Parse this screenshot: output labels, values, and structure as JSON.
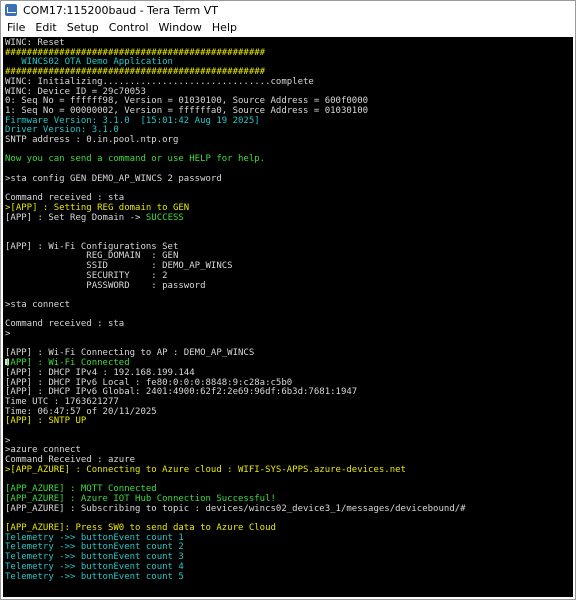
{
  "window": {
    "title": "COM17:115200baud - Tera Term VT",
    "menu": [
      "File",
      "Edit",
      "Setup",
      "Control",
      "Window",
      "Help"
    ]
  },
  "colors": {
    "default": "#d8d8d8",
    "green": "#3ddc3d",
    "cyan": "#20c8c8",
    "yellow": "#e8e800",
    "blue": "#3a78ff",
    "background": "#000000"
  },
  "terminal": {
    "lines": [
      {
        "segments": [
          {
            "text": "WINC: Reset",
            "color": "default"
          }
        ]
      },
      {
        "segments": [
          {
            "text": "################################################",
            "color": "yellow"
          }
        ]
      },
      {
        "segments": [
          {
            "text": "   WINCS02 OTA Demo Application",
            "color": "cyan"
          }
        ]
      },
      {
        "segments": [
          {
            "text": "################################################",
            "color": "yellow"
          }
        ]
      },
      {
        "segments": [
          {
            "text": "WINC: Initializing...............................complete",
            "color": "default"
          }
        ]
      },
      {
        "segments": [
          {
            "text": "WINC: Device ID = 29c70053",
            "color": "default"
          }
        ]
      },
      {
        "segments": [
          {
            "text": "0: Seq No = ffffff98, Version = 01030100, Source Address = 600f0000",
            "color": "default"
          }
        ]
      },
      {
        "segments": [
          {
            "text": "1: Seq No = 00000002, Version = ffffffa0, Source Address = 01030100",
            "color": "default"
          }
        ]
      },
      {
        "segments": [
          {
            "text": "Firmware Version: 3.1.0  [15:01:42 Aug 19 2025]",
            "color": "cyan"
          }
        ]
      },
      {
        "segments": [
          {
            "text": "Driver Version: 3.1.0",
            "color": "cyan"
          }
        ]
      },
      {
        "segments": [
          {
            "text": "SNTP address : 0.in.pool.ntp.org",
            "color": "default"
          }
        ]
      },
      {
        "segments": [
          {
            "text": "",
            "color": "default"
          }
        ]
      },
      {
        "segments": [
          {
            "text": "Now you can send a command or use HELP for help.",
            "color": "green"
          }
        ]
      },
      {
        "segments": [
          {
            "text": "",
            "color": "default"
          }
        ]
      },
      {
        "segments": [
          {
            "text": ">sta config GEN DEMO_AP_WINCS 2 password",
            "color": "default"
          }
        ]
      },
      {
        "segments": [
          {
            "text": "",
            "color": "default"
          }
        ]
      },
      {
        "segments": [
          {
            "text": "Command received : sta",
            "color": "default"
          }
        ]
      },
      {
        "segments": [
          {
            "text": ">[APP] : Setting REG domain to GEN",
            "color": "yellow"
          }
        ]
      },
      {
        "segments": [
          {
            "text": "[APP] : Set Reg Domain -> ",
            "color": "default"
          },
          {
            "text": "SUCCESS",
            "color": "green"
          }
        ]
      },
      {
        "segments": [
          {
            "text": "",
            "color": "default"
          }
        ]
      },
      {
        "segments": [
          {
            "text": "",
            "color": "default"
          }
        ]
      },
      {
        "segments": [
          {
            "text": "[APP] : Wi-Fi Configurations Set",
            "color": "default"
          }
        ]
      },
      {
        "segments": [
          {
            "text": "               REG_DOMAIN  : GEN",
            "color": "default"
          }
        ]
      },
      {
        "segments": [
          {
            "text": "               SSID        : DEMO_AP_WINCS",
            "color": "default"
          }
        ]
      },
      {
        "segments": [
          {
            "text": "               SECURITY    : 2",
            "color": "default"
          }
        ]
      },
      {
        "segments": [
          {
            "text": "               PASSWORD    : password",
            "color": "default"
          }
        ]
      },
      {
        "segments": [
          {
            "text": "",
            "color": "default"
          }
        ]
      },
      {
        "segments": [
          {
            "text": ">sta connect",
            "color": "default"
          }
        ]
      },
      {
        "segments": [
          {
            "text": "",
            "color": "default"
          }
        ]
      },
      {
        "segments": [
          {
            "text": "Command received : sta",
            "color": "default"
          }
        ]
      },
      {
        "segments": [
          {
            "text": ">",
            "color": "default"
          }
        ]
      },
      {
        "segments": [
          {
            "text": "",
            "color": "default"
          }
        ]
      },
      {
        "segments": [
          {
            "text": "[APP] : Wi-Fi Connecting to AP : DEMO_AP_WINCS",
            "color": "default"
          }
        ]
      },
      {
        "segments": [
          {
            "text": "[APP] : Wi-Fi Connected",
            "color": "green"
          }
        ]
      },
      {
        "segments": [
          {
            "text": "[APP] : DHCP IPv4 : 192.168.199.144",
            "color": "default"
          }
        ]
      },
      {
        "segments": [
          {
            "text": "[APP] : DHCP IPv6 Local : fe80:0:0:0:8848:9:c28a:c5b0",
            "color": "default"
          }
        ]
      },
      {
        "segments": [
          {
            "text": "[APP] : DHCP IPv6 Global: 2401:4900:62f2:2e69:96df:6b3d:7681:1947",
            "color": "default"
          }
        ]
      },
      {
        "segments": [
          {
            "text": "Time UTC : 1763621277",
            "color": "default"
          }
        ]
      },
      {
        "segments": [
          {
            "text": "Time: 06:47:57 of 20/11/2025",
            "color": "default"
          }
        ]
      },
      {
        "segments": [
          {
            "text": "[APP] : SNTP UP",
            "color": "yellow"
          }
        ]
      },
      {
        "segments": [
          {
            "text": "",
            "color": "default"
          }
        ]
      },
      {
        "segments": [
          {
            "text": ">",
            "color": "default"
          }
        ]
      },
      {
        "segments": [
          {
            "text": ">azure connect",
            "color": "default"
          }
        ]
      },
      {
        "segments": [
          {
            "text": "Command Received : azure",
            "color": "default"
          }
        ]
      },
      {
        "segments": [
          {
            "text": ">[APP_AZURE] : Connecting to Azure cloud : WIFI-SYS-APPS.azure-devices.net",
            "color": "yellow"
          }
        ]
      },
      {
        "segments": [
          {
            "text": "",
            "color": "default"
          }
        ]
      },
      {
        "segments": [
          {
            "text": "[APP_AZURE] : MQTT Connected",
            "color": "green"
          }
        ]
      },
      {
        "segments": [
          {
            "text": "[APP_AZURE] : Azure IOT Hub Connection Successful!",
            "color": "green"
          }
        ]
      },
      {
        "segments": [
          {
            "text": "[APP_AZURE] : Subscribing to topic : devices/wincs02_device3_1/messages/devicebound/#",
            "color": "default"
          }
        ]
      },
      {
        "segments": [
          {
            "text": "",
            "color": "default"
          }
        ]
      },
      {
        "segments": [
          {
            "text": "[APP_AZURE]: Press SW0 to send data to Azure Cloud",
            "color": "yellow"
          }
        ]
      },
      {
        "segments": [
          {
            "text": "Telemetry ->> buttonEvent count 1",
            "color": "cyan"
          }
        ]
      },
      {
        "segments": [
          {
            "text": "Telemetry ->> buttonEvent count 2",
            "color": "cyan"
          }
        ]
      },
      {
        "segments": [
          {
            "text": "Telemetry ->> buttonEvent count 3",
            "color": "cyan"
          }
        ]
      },
      {
        "segments": [
          {
            "text": "Telemetry ->> buttonEvent count 4",
            "color": "cyan"
          }
        ]
      },
      {
        "segments": [
          {
            "text": "Telemetry ->> buttonEvent count 5",
            "color": "cyan"
          }
        ]
      }
    ]
  }
}
